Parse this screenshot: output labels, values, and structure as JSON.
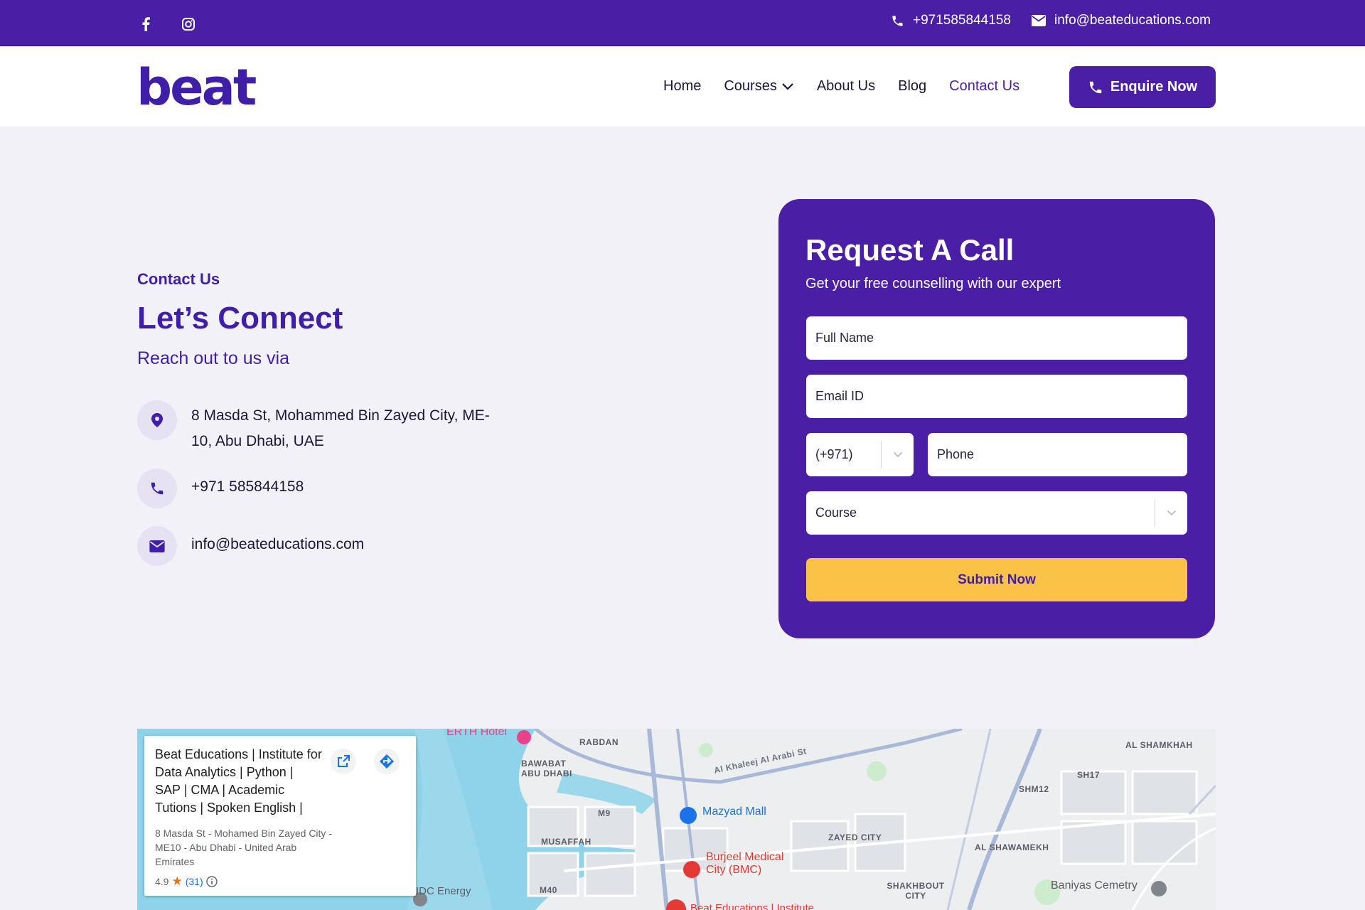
{
  "topbar": {
    "phone": "+971585844158",
    "email": "info@beateducations.com"
  },
  "header": {
    "logo": "beat",
    "nav": {
      "home": "Home",
      "courses": "Courses",
      "about": "About Us",
      "blog": "Blog",
      "contact": "Contact Us"
    },
    "enquire_label": "Enquire Now"
  },
  "contact_section": {
    "eyebrow": "Contact Us",
    "headline": "Let’s Connect",
    "subline": "Reach out to us via",
    "address": "8 Masda St, Mohammed Bin Zayed City, ME-10, Abu Dhabi, UAE",
    "phone": "+971 585844158",
    "email": "info@beateducations.com"
  },
  "form": {
    "title": "Request A Call",
    "subtitle": "Get your free counselling with our expert",
    "full_name_placeholder": "Full Name",
    "email_placeholder": "Email ID",
    "country_code": "(+971)",
    "phone_placeholder": "Phone",
    "course_placeholder": "Course",
    "submit_label": "Submit Now"
  },
  "map": {
    "place_title": "Beat Educations | Institute for Data Analytics | Python | SAP | CMA | Academic Tutions | Spoken English |",
    "place_address": "8 Masda St - Mohamed Bin Zayed City - ME10 - Abu Dhabi - United Arab Emirates",
    "rating": "4.9",
    "review_count": "(31)",
    "labels": {
      "erth": "ERTH Hotel",
      "rabdan": "RABDAN",
      "bawabat": "BAWABAT ABU DHABI",
      "musaffah": "MUSAFFAH",
      "m9": "M9",
      "m40": "M40",
      "mazyad": "Mazyad Mall",
      "burjeel": "Burjeel Medical City (BMC)",
      "zayed_city": "ZAYED CITY",
      "shakhbout": "SHAKHBOUT CITY",
      "al_shamkhah": "AL SHAMKHAH",
      "shm12": "SHM12",
      "sh17": "SH17",
      "al_shawamekh": "AL SHAWAMEKH",
      "baniyas": "Baniyas Cemetry",
      "idc": "IDC Energy",
      "khaleej": "Al Khaleej Al Arabi St",
      "beat_pin": "Beat Educations | Institute"
    }
  },
  "colors": {
    "primary": "#4a1fa6",
    "accent": "#fbc248",
    "page_bg": "#f3f1f8"
  }
}
